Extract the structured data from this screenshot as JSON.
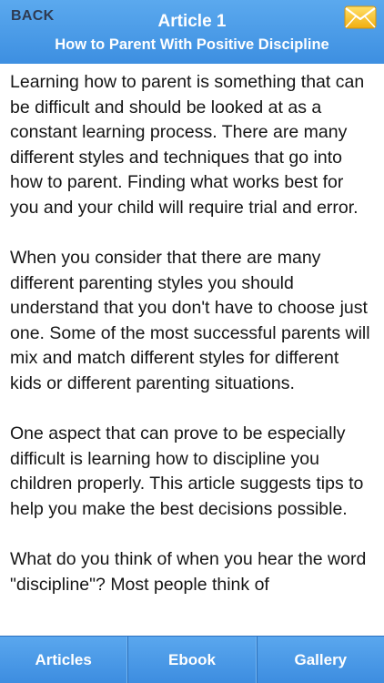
{
  "header": {
    "back_label": "BACK",
    "title": "Article 1",
    "subtitle": "How to Parent With Positive Discipline",
    "mail_icon": "envelope-icon"
  },
  "article": {
    "paragraphs": [
      "Learning how to parent is something that can be difficult and should be looked at as a constant learning process. There are many different styles and techniques that go into how to parent. Finding what works best for you and your child will require trial and error.",
      "When you consider that there are many different parenting styles you should understand that you don't have to choose just one. Some of the most successful parents will mix and match different styles for different kids or different parenting situations.",
      "One aspect that can prove to be especially difficult is learning how to discipline you children properly. This article suggests tips to help you make the best decisions possible.",
      "What do you think of when you hear the word \"discipline\"? Most people think of"
    ]
  },
  "tabbar": {
    "articles_label": "Articles",
    "ebook_label": "Ebook",
    "gallery_label": "Gallery"
  },
  "colors": {
    "header_blue": "#4a9be8",
    "back_text": "#2f3b52",
    "envelope_yellow": "#f7c21e"
  }
}
